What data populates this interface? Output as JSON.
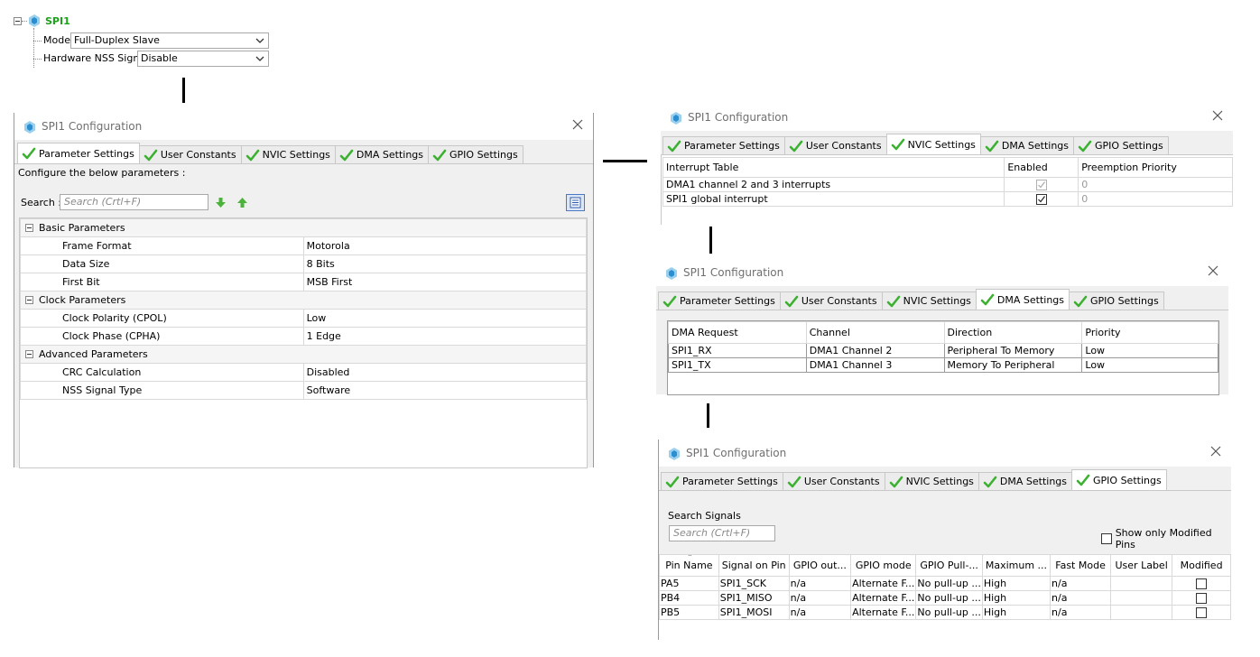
{
  "tree": {
    "title": "SPI1",
    "mode_label": "Mode",
    "mode_value": "Full-Duplex Slave",
    "nss_label": "Hardware NSS Signal",
    "nss_value": "Disable"
  },
  "dialog_title": "SPI1 Configuration",
  "tabs": {
    "parameter": "Parameter Settings",
    "user": "User Constants",
    "nvic": "NVIC Settings",
    "dma": "DMA Settings",
    "gpio": "GPIO Settings"
  },
  "params": {
    "configure_text": "Configure the below parameters :",
    "search_label": "Search :",
    "search_placeholder": "Search (Crtl+F)",
    "groups": [
      {
        "name": "Basic Parameters",
        "rows": [
          {
            "name": "Frame Format",
            "value": "Motorola"
          },
          {
            "name": "Data Size",
            "value": "8 Bits"
          },
          {
            "name": "First Bit",
            "value": "MSB First"
          }
        ]
      },
      {
        "name": "Clock Parameters",
        "rows": [
          {
            "name": "Clock Polarity (CPOL)",
            "value": "Low"
          },
          {
            "name": "Clock Phase (CPHA)",
            "value": "1 Edge"
          }
        ]
      },
      {
        "name": "Advanced Parameters",
        "rows": [
          {
            "name": "CRC Calculation",
            "value": "Disabled"
          },
          {
            "name": "NSS Signal Type",
            "value": "Software"
          }
        ]
      }
    ]
  },
  "nvic": {
    "headers": [
      "Interrupt Table",
      "Enabled",
      "Preemption Priority"
    ],
    "rows": [
      {
        "name": "DMA1 channel 2 and 3 interrupts",
        "enabled": true,
        "disabled": true,
        "priority": "0"
      },
      {
        "name": "SPI1 global interrupt",
        "enabled": true,
        "disabled": false,
        "priority": "0"
      }
    ]
  },
  "dma": {
    "headers": [
      "DMA Request",
      "Channel",
      "Direction",
      "Priority"
    ],
    "rows": [
      [
        "SPI1_RX",
        "DMA1 Channel 2",
        "Peripheral To Memory",
        "Low"
      ],
      [
        "SPI1_TX",
        "DMA1 Channel 3",
        "Memory To Peripheral",
        "Low"
      ]
    ]
  },
  "gpio": {
    "search_label": "Search Signals",
    "search_placeholder": "Search (Crtl+F)",
    "show_modified": "Show only Modified Pins",
    "headers": [
      "Pin Name",
      "Signal on Pin",
      "GPIO out...",
      "GPIO mode",
      "GPIO Pull-...",
      "Maximum ...",
      "Fast Mode",
      "User Label",
      "Modified"
    ],
    "rows": [
      [
        "PA5",
        "SPI1_SCK",
        "n/a",
        "Alternate F...",
        "No pull-up ...",
        "High",
        "n/a",
        "",
        ""
      ],
      [
        "PB4",
        "SPI1_MISO",
        "n/a",
        "Alternate F...",
        "No pull-up ...",
        "High",
        "n/a",
        "",
        ""
      ],
      [
        "PB5",
        "SPI1_MOSI",
        "n/a",
        "Alternate F...",
        "No pull-up ...",
        "High",
        "n/a",
        "",
        ""
      ]
    ]
  },
  "colors": {
    "tree_title": "#1aa318",
    "check_green": "#3cb031",
    "title_gray": "#6f6f6f"
  }
}
